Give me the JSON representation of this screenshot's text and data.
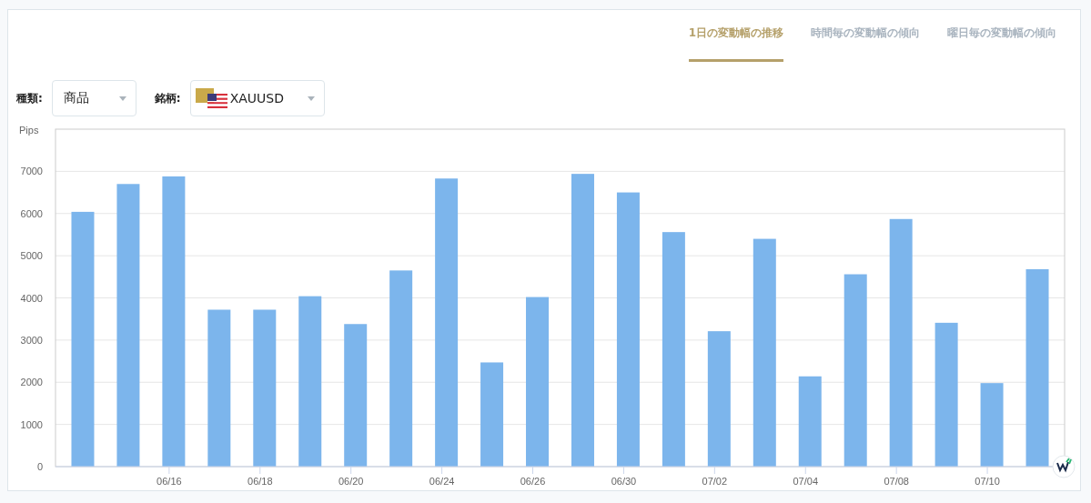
{
  "tabs": [
    {
      "label": "1日の変動幅の推移",
      "selected": true
    },
    {
      "label": "時間毎の変動幅の傾向",
      "selected": false
    },
    {
      "label": "曜日毎の変動幅の傾向",
      "selected": false
    }
  ],
  "filters": [
    {
      "label": "種類:",
      "value": "商品",
      "kind": "plain"
    },
    {
      "label": "銘柄:",
      "value": "XAUUSD",
      "kind": "symbol"
    }
  ],
  "chart": {
    "chart_data": {
      "type": "bar",
      "ylabel": "Pips",
      "ylim": [
        0,
        8000
      ],
      "yticks": [
        0,
        1000,
        2000,
        3000,
        4000,
        5000,
        6000,
        7000
      ],
      "grid": true,
      "categories": [
        null,
        null,
        "06/16",
        null,
        "06/18",
        null,
        "06/20",
        null,
        "06/24",
        null,
        "06/26",
        null,
        "06/30",
        null,
        "07/02",
        null,
        "07/04",
        null,
        "07/08",
        null,
        "07/10",
        null
      ],
      "series": [
        {
          "color": "#7cb5ec",
          "values": [
            6040,
            6700,
            6880,
            3720,
            3720,
            4040,
            3380,
            4650,
            6830,
            2470,
            4020,
            6940,
            6500,
            5560,
            3210,
            5400,
            2140,
            4560,
            5870,
            3410,
            1980,
            4680
          ]
        }
      ]
    }
  }
}
